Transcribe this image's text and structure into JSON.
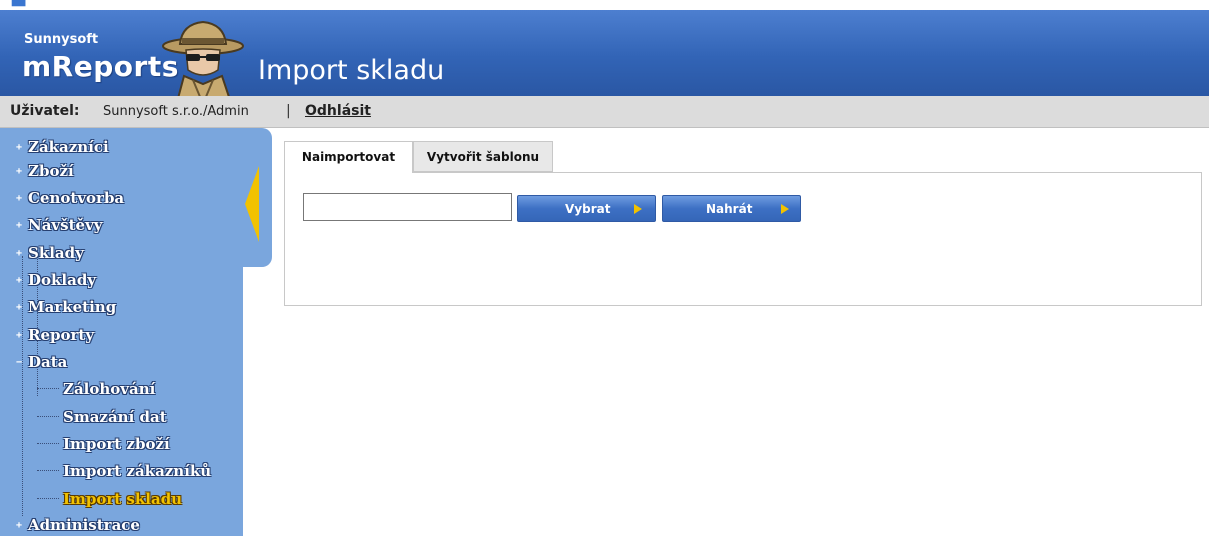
{
  "brand": {
    "company": "Sunnysoft",
    "product": "mReports"
  },
  "page": {
    "title": "Import skladu"
  },
  "userbar": {
    "user_label": "Uživatel:",
    "user_value": "Sunnysoft s.r.o./Admin",
    "separator": "|",
    "logout": "Odhlásit"
  },
  "sidebar": {
    "items": [
      {
        "label": "Zákazníci",
        "expander": "+"
      },
      {
        "label": "Zboží",
        "expander": "+"
      },
      {
        "label": "Cenotvorba",
        "expander": "+"
      },
      {
        "label": "Návštěvy",
        "expander": "+"
      },
      {
        "label": "Sklady",
        "expander": "+"
      },
      {
        "label": "Doklady",
        "expander": "+"
      },
      {
        "label": "Marketing",
        "expander": "+"
      },
      {
        "label": "Reporty",
        "expander": "+"
      },
      {
        "label": "Data",
        "expander": "−"
      },
      {
        "label": "Administrace",
        "expander": "+"
      }
    ],
    "data_children": [
      {
        "label": "Zálohování"
      },
      {
        "label": "Smazání dat"
      },
      {
        "label": "Import zboží"
      },
      {
        "label": "Import zákazníků"
      },
      {
        "label": "Import skladu",
        "active": true
      }
    ]
  },
  "tabs": [
    {
      "label": "Naimportovat",
      "active": true
    },
    {
      "label": "Vytvořit šablonu",
      "active": false
    }
  ],
  "form": {
    "file_value": "",
    "select_button": "Vybrat",
    "upload_button": "Nahrát"
  },
  "colors": {
    "header_blue": "#3264b6",
    "sidebar_blue": "#7aa6dd",
    "accent_yellow": "#f2c200",
    "userbar_gray": "#dcdcdc"
  },
  "icons": {
    "mascot": "detective-mascot-icon",
    "tab_arrow": "collapse-arrow-icon",
    "button_arrow": "play-arrow-icon"
  }
}
